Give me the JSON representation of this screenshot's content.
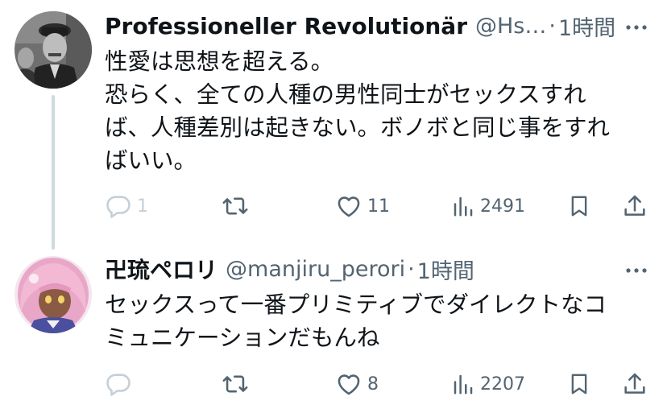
{
  "tweets": [
    {
      "display_name": "Professioneller Revolutionär",
      "handle": "@Hs…",
      "separator": "·",
      "time": "1時間",
      "text_lines": [
        "性愛は思想を超える。",
        "恐らく、全ての人種の男性同士がセックスすれ",
        "ば、人種差別は起きない。ボノボと同じ事をすれ",
        "ばいい。"
      ],
      "replies": "1",
      "retweets": "",
      "likes": "11",
      "views": "2491"
    },
    {
      "display_name": "卍琉ペロリ",
      "handle": "@manjiru_perori",
      "separator": "·",
      "time": "1時間",
      "text_lines": [
        "セックスって一番プリミティブでダイレクトなコ",
        "ミュニケーションだもんね"
      ],
      "replies": "",
      "retweets": "",
      "likes": "8",
      "views": "2207"
    }
  ],
  "icons": {
    "reply": "reply-icon",
    "retweet": "retweet-icon",
    "like": "heart-icon",
    "views": "views-bar-chart-icon",
    "bookmark": "bookmark-icon",
    "share": "share-icon",
    "more": "more-dots-icon"
  },
  "colors": {
    "text_primary": "#0f1419",
    "text_secondary": "#536471",
    "thread_line": "#cfd9de"
  }
}
